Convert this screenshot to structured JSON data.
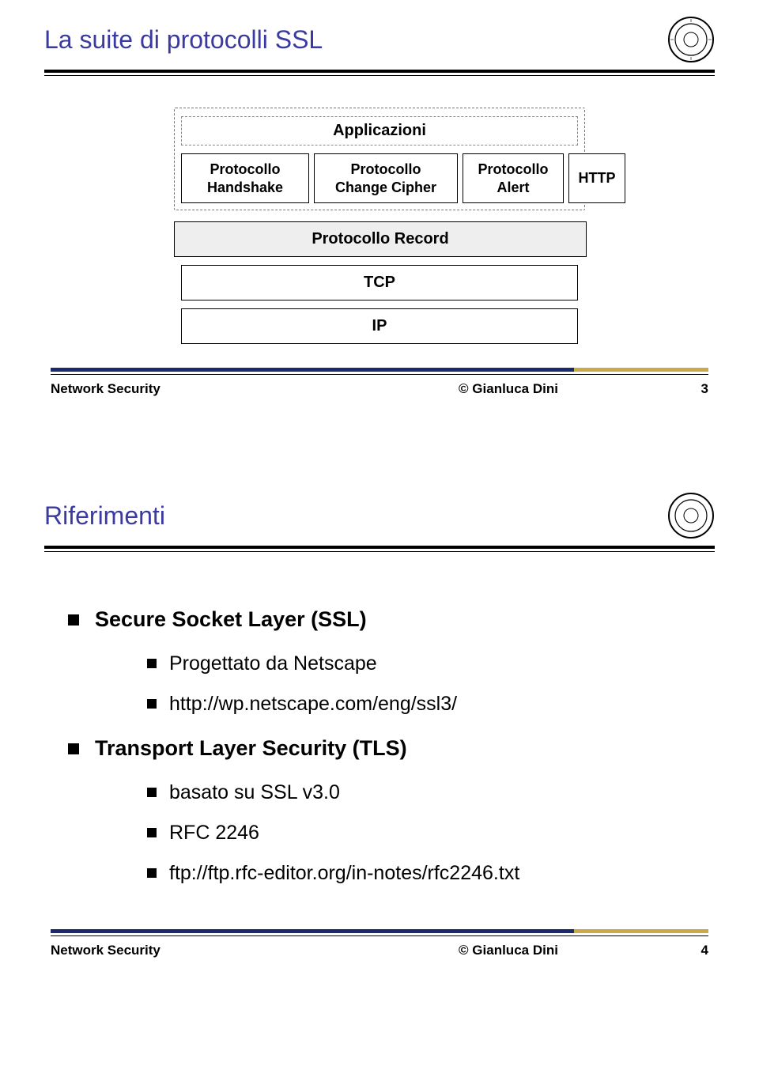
{
  "slide1": {
    "title": "La suite di protocolli SSL",
    "diagram": {
      "applications": "Applicazioni",
      "handshake_l1": "Protocollo",
      "handshake_l2": "Handshake",
      "change_l1": "Protocollo",
      "change_l2": "Change Cipher",
      "alert_l1": "Protocollo",
      "alert_l2": "Alert",
      "http": "HTTP",
      "record": "Protocollo Record",
      "tcp": "TCP",
      "ip": "IP"
    },
    "footer": {
      "left": "Network Security",
      "mid": "© Gianluca Dini",
      "page": "3"
    }
  },
  "slide2": {
    "title": "Riferimenti",
    "items": {
      "ssl_heading": "Secure Socket Layer (SSL)",
      "ssl_sub1": "Progettato da Netscape",
      "ssl_sub2": "http://wp.netscape.com/eng/ssl3/",
      "tls_heading": "Transport Layer Security (TLS)",
      "tls_sub1": "basato su SSL v3.0",
      "tls_sub2": "RFC 2246",
      "tls_sub3": "ftp://ftp.rfc-editor.org/in-notes/rfc2246.txt"
    },
    "footer": {
      "left": "Network Security",
      "mid": "© Gianluca Dini",
      "page": "4"
    }
  }
}
